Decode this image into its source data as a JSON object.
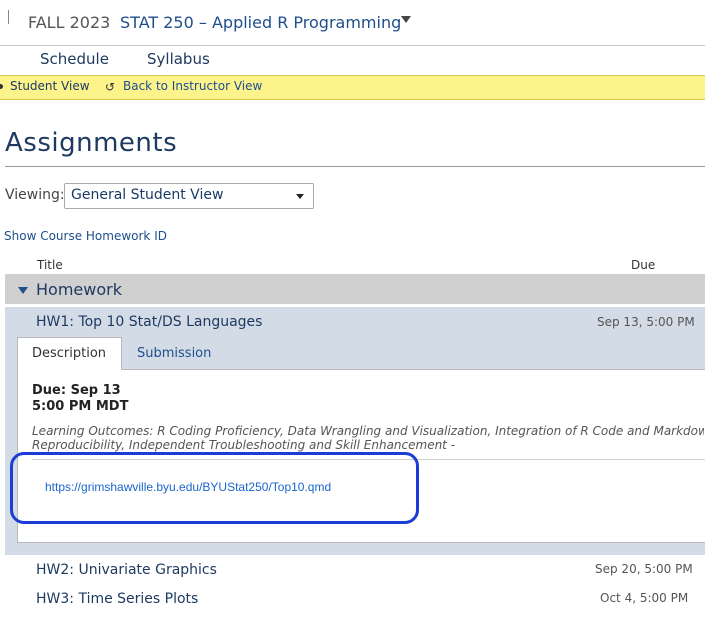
{
  "header": {
    "term": "FALL 2023",
    "course": "STAT 250 – Applied R Programming"
  },
  "nav": {
    "items": [
      {
        "label": "Schedule"
      },
      {
        "label": "Syllabus"
      }
    ]
  },
  "student_view": {
    "label": "Student View",
    "back_label": "Back to Instructor View"
  },
  "page": {
    "title": "Assignments",
    "viewing_label": "Viewing:",
    "viewing_value": "General Student View",
    "homework_id_link": "Show Course Homework ID"
  },
  "table": {
    "col_title": "Title",
    "col_due": "Due",
    "group": "Homework",
    "hw1": {
      "title": "HW1: Top 10 Stat/DS Languages",
      "due": "Sep 13, 5:00 PM",
      "tabs": [
        "Description",
        "Submission"
      ],
      "due_date": "Due: Sep 13",
      "due_time": "5:00 PM MDT",
      "outcomes_line1": "Learning Outcomes: R Coding Proficiency, Data Wrangling and Visualization, Integration of R Code and Markdown with",
      "outcomes_line2": "Reproducibility, Independent Troubleshooting and Skill Enhancement -",
      "link": "https://grimshawville.byu.edu/BYUStat250/Top10.qmd"
    },
    "rows": [
      {
        "title": "HW2: Univariate Graphics",
        "due": "Sep 20, 5:00 PM"
      },
      {
        "title": "HW3: Time Series Plots",
        "due": "Oct 4, 5:00 PM"
      }
    ]
  },
  "colors": {
    "accent": "#1f4e8c",
    "highlight_bar": "#fcf38a",
    "annotation": "#1b3dd6"
  }
}
